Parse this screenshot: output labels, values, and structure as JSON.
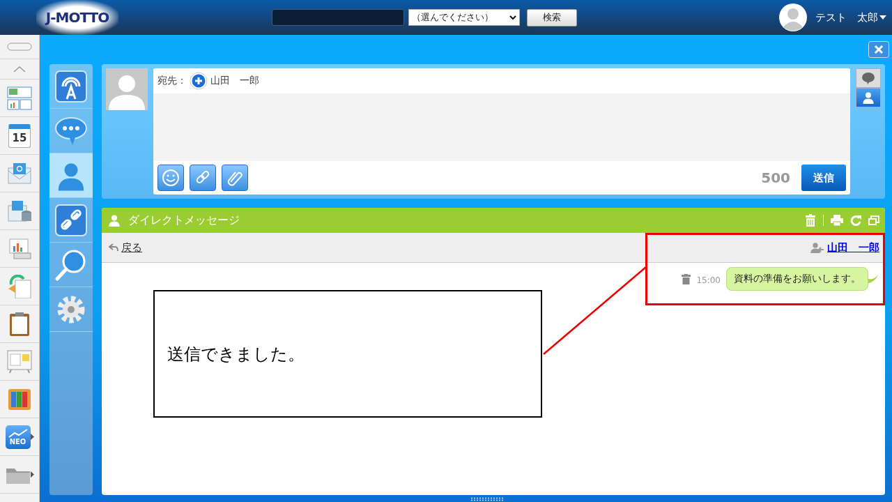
{
  "header": {
    "logo": "J-MOTTO",
    "category_select": {
      "value": "（選んでください）"
    },
    "search_button": "検索",
    "user_name": "テスト　太郎"
  },
  "rail_items": [
    {
      "kind": "collapse"
    },
    {
      "kind": "up"
    },
    {
      "kind": "dashboard"
    },
    {
      "kind": "calendar",
      "label": "15"
    },
    {
      "kind": "mail"
    },
    {
      "kind": "maildb"
    },
    {
      "kind": "presentation"
    },
    {
      "kind": "docsync"
    },
    {
      "kind": "clipboard"
    },
    {
      "kind": "board"
    },
    {
      "kind": "binders"
    },
    {
      "kind": "neo",
      "label": "NEO",
      "expandable": true
    },
    {
      "kind": "folder",
      "expandable": true
    }
  ],
  "side_nav": [
    {
      "kind": "broadcast",
      "selected": false
    },
    {
      "kind": "chat",
      "selected": false
    },
    {
      "kind": "person",
      "selected": true
    },
    {
      "kind": "link",
      "selected": false
    },
    {
      "kind": "search",
      "selected": false
    },
    {
      "kind": "settings",
      "selected": false
    }
  ],
  "compose": {
    "to_label": "宛先：",
    "recipient": "山田　一郎",
    "tools": [
      {
        "kind": "smile"
      },
      {
        "kind": "link"
      },
      {
        "kind": "clip"
      }
    ],
    "char_count": "500",
    "send_button": "送信",
    "modes": [
      {
        "kind": "chat",
        "selected": false
      },
      {
        "kind": "person",
        "selected": true
      }
    ]
  },
  "dm_panel": {
    "title": "ダイレクトメッセージ",
    "back_link": "戻る",
    "partner": "山田　一郎",
    "messages": [
      {
        "time": "15:00",
        "text": "資料の準備をお願いします。"
      }
    ]
  },
  "callout": {
    "text": "送信できました。"
  }
}
